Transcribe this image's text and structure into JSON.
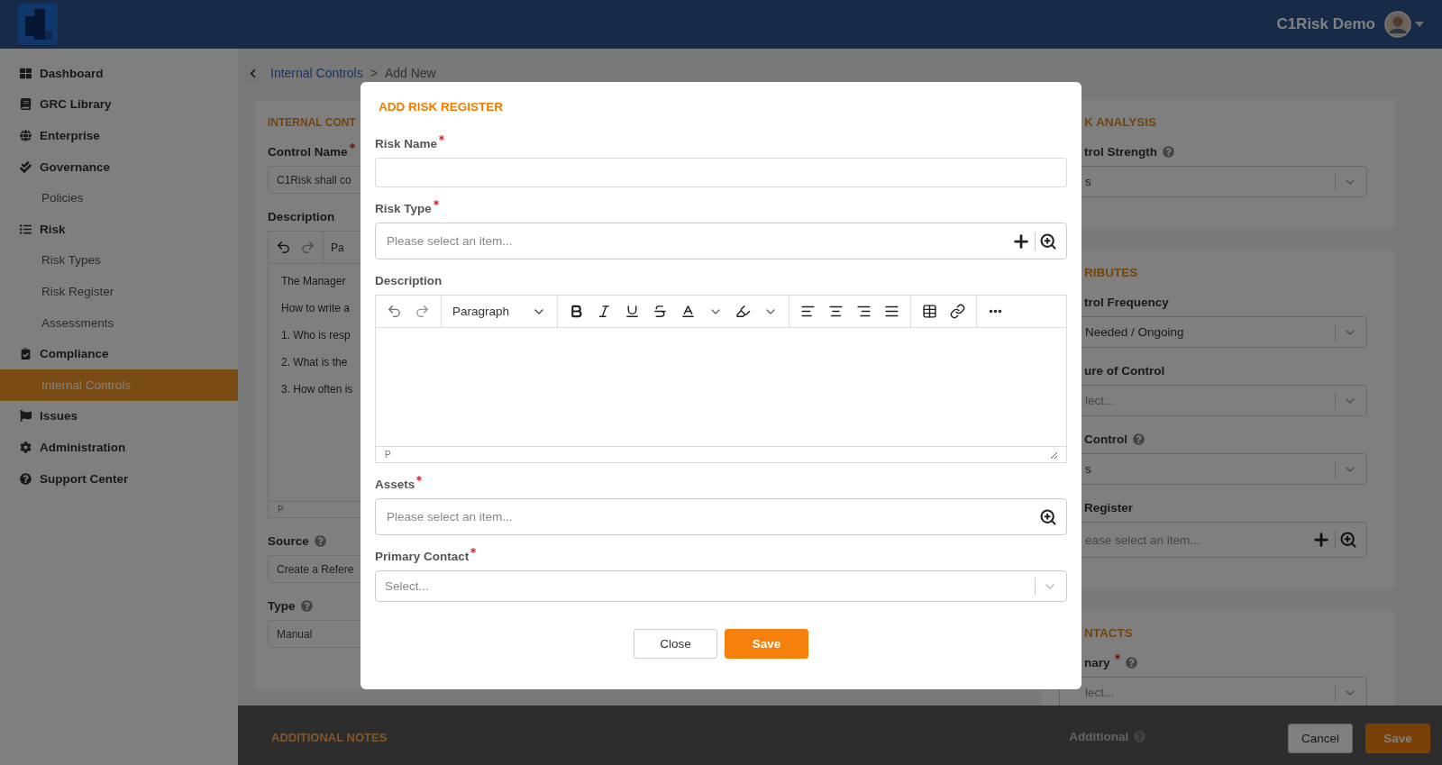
{
  "header": {
    "user_name": "C1Risk Demo"
  },
  "sidebar": {
    "items": [
      {
        "label": "Dashboard",
        "selected": false
      },
      {
        "label": "GRC Library",
        "selected": false
      },
      {
        "label": "Enterprise",
        "selected": false
      },
      {
        "label": "Governance",
        "selected": false,
        "children": [
          {
            "label": "Policies",
            "selected": false
          }
        ]
      },
      {
        "label": "Risk",
        "selected": false,
        "children": [
          {
            "label": "Risk Types",
            "selected": false
          },
          {
            "label": "Risk Register",
            "selected": false
          },
          {
            "label": "Assessments",
            "selected": false
          }
        ]
      },
      {
        "label": "Compliance",
        "selected": false,
        "children": [
          {
            "label": "Internal Controls",
            "selected": true
          }
        ]
      },
      {
        "label": "Issues",
        "selected": false
      },
      {
        "label": "Administration",
        "selected": false
      },
      {
        "label": "Support Center",
        "selected": false
      }
    ]
  },
  "breadcrumb": {
    "link": "Internal Controls",
    "separator": ">",
    "current": "Add New"
  },
  "left_card": {
    "title": "INTERNAL CONT",
    "fields": [
      {
        "kind": "text",
        "label": "Control Name",
        "required": true,
        "help": false,
        "value": "C1Risk shall co"
      },
      {
        "kind": "editor",
        "label": "Description",
        "required": false,
        "help": false,
        "block_format": "Pa",
        "lines": [
          "The Manager",
          "How to write a",
          "1. Who is resp",
          "2. What is the",
          "3. How often is"
        ],
        "status": "P"
      },
      {
        "kind": "text",
        "label": "Source",
        "required": false,
        "help": true,
        "value": "Create a Refere"
      },
      {
        "kind": "text",
        "label": "Type",
        "required": false,
        "help": true,
        "value": "Manual"
      }
    ]
  },
  "right_cards": [
    {
      "title": "K ANALYSIS",
      "fields": [
        {
          "kind": "select",
          "label": "trol Strength",
          "required": false,
          "help": true,
          "value": "s"
        }
      ]
    },
    {
      "title": "RIBUTES",
      "fields": [
        {
          "kind": "select",
          "label": "trol Frequency",
          "required": false,
          "help": false,
          "value": "Needed / Ongoing"
        },
        {
          "kind": "select",
          "label": "ure of Control",
          "required": false,
          "help": false,
          "placeholder": "lect..."
        },
        {
          "kind": "select",
          "label": "Control",
          "required": false,
          "help": true,
          "value": "s"
        },
        {
          "kind": "lookup",
          "label": "Register",
          "required": false,
          "help": false,
          "placeholder": "ease select an item..."
        }
      ]
    },
    {
      "title": "NTACTS",
      "fields": [
        {
          "kind": "select",
          "label": "nary",
          "required": true,
          "help": true,
          "placeholder": "lect..."
        }
      ]
    }
  ],
  "footer": {
    "section_title": "ADDITIONAL NOTES",
    "field_label": "Additional",
    "buttons": [
      {
        "label": "Cancel",
        "kind": "secondary"
      },
      {
        "label": "Save",
        "kind": "primary"
      }
    ]
  },
  "modal": {
    "title": "ADD RISK REGISTER",
    "fields": [
      {
        "kind": "text",
        "label": "Risk Name",
        "required": true
      },
      {
        "kind": "lookup",
        "label": "Risk Type",
        "required": true,
        "placeholder": "Please select an item...",
        "add": true
      },
      {
        "kind": "editor",
        "label": "Description",
        "required": false,
        "block_format": "Paragraph",
        "status": "P"
      },
      {
        "kind": "lookup",
        "label": "Assets",
        "required": true,
        "placeholder": "Please select an item...",
        "add": false
      },
      {
        "kind": "select",
        "label": "Primary Contact",
        "required": true,
        "placeholder": "Select..."
      }
    ],
    "buttons": [
      {
        "label": "Close",
        "kind": "secondary"
      },
      {
        "label": "Save",
        "kind": "primary"
      }
    ]
  }
}
